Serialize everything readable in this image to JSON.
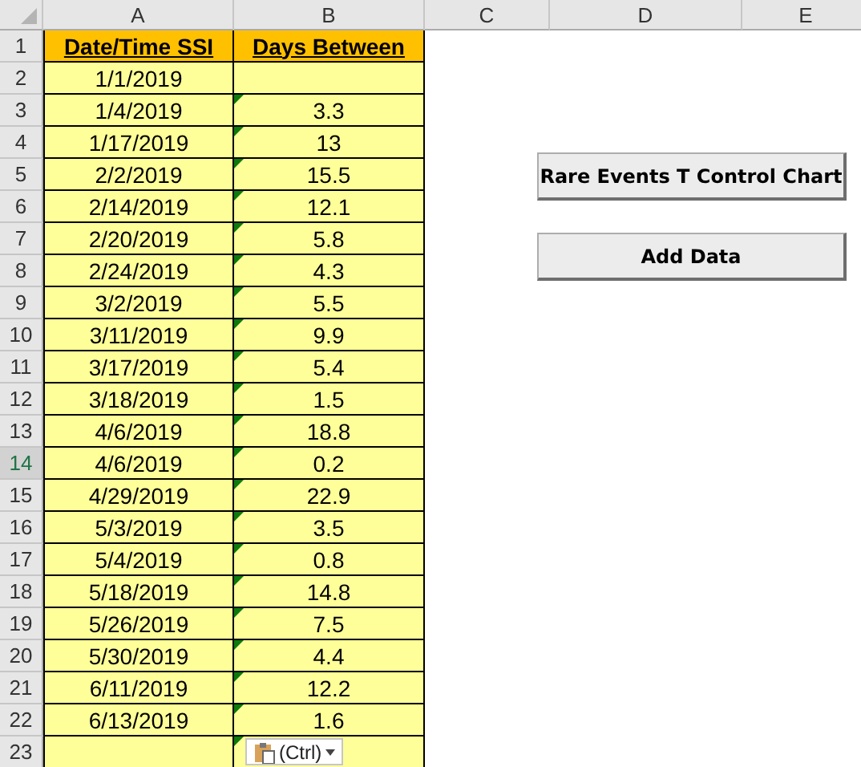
{
  "column_headers": [
    {
      "label": "A"
    },
    {
      "label": "B"
    },
    {
      "label": "C"
    },
    {
      "label": "D"
    },
    {
      "label": "E"
    }
  ],
  "header_row": {
    "number": "1",
    "cells": [
      "Date/Time SSI",
      "Days Between"
    ]
  },
  "rows": [
    {
      "number": "2",
      "selected": false,
      "date": "1/1/2019",
      "error_flag": false
    },
    {
      "number": "3",
      "selected": false,
      "date": "1/4/2019",
      "days": "3.3",
      "error_flag": true
    },
    {
      "number": "4",
      "selected": false,
      "date": "1/17/2019",
      "days": "13",
      "error_flag": true
    },
    {
      "number": "5",
      "selected": false,
      "date": "2/2/2019",
      "days": "15.5",
      "error_flag": true
    },
    {
      "number": "6",
      "selected": false,
      "date": "2/14/2019",
      "days": "12.1",
      "error_flag": true
    },
    {
      "number": "7",
      "selected": false,
      "date": "2/20/2019",
      "days": "5.8",
      "error_flag": true
    },
    {
      "number": "8",
      "selected": false,
      "date": "2/24/2019",
      "days": "4.3",
      "error_flag": true
    },
    {
      "number": "9",
      "selected": false,
      "date": "3/2/2019",
      "days": "5.5",
      "error_flag": true
    },
    {
      "number": "10",
      "selected": false,
      "date": "3/11/2019",
      "days": "9.9",
      "error_flag": true
    },
    {
      "number": "11",
      "selected": false,
      "date": "3/17/2019",
      "days": "5.4",
      "error_flag": true
    },
    {
      "number": "12",
      "selected": false,
      "date": "3/18/2019",
      "days": "1.5",
      "error_flag": true
    },
    {
      "number": "13",
      "selected": false,
      "date": "4/6/2019",
      "days": "18.8",
      "error_flag": true
    },
    {
      "number": "14",
      "selected": true,
      "date": "4/6/2019",
      "days": "0.2",
      "error_flag": true
    },
    {
      "number": "15",
      "selected": false,
      "date": "4/29/2019",
      "days": "22.9",
      "error_flag": true
    },
    {
      "number": "16",
      "selected": false,
      "date": "5/3/2019",
      "days": "3.5",
      "error_flag": true
    },
    {
      "number": "17",
      "selected": false,
      "date": "5/4/2019",
      "days": "0.8",
      "error_flag": true
    },
    {
      "number": "18",
      "selected": false,
      "date": "5/18/2019",
      "days": "14.8",
      "error_flag": true
    },
    {
      "number": "19",
      "selected": false,
      "date": "5/26/2019",
      "days": "7.5",
      "error_flag": true
    },
    {
      "number": "20",
      "selected": false,
      "date": "5/30/2019",
      "days": "4.4",
      "error_flag": true
    },
    {
      "number": "21",
      "selected": false,
      "date": "6/11/2019",
      "days": "12.2",
      "error_flag": true
    },
    {
      "number": "22",
      "selected": false,
      "date": "6/13/2019",
      "days": "1.6",
      "error_flag": true
    },
    {
      "number": "23",
      "selected": false,
      "error_flag": true
    }
  ],
  "buttons": [
    "Rare Events T Control Chart",
    "Add Data"
  ],
  "paste_options": {
    "label": "(Ctrl)"
  }
}
